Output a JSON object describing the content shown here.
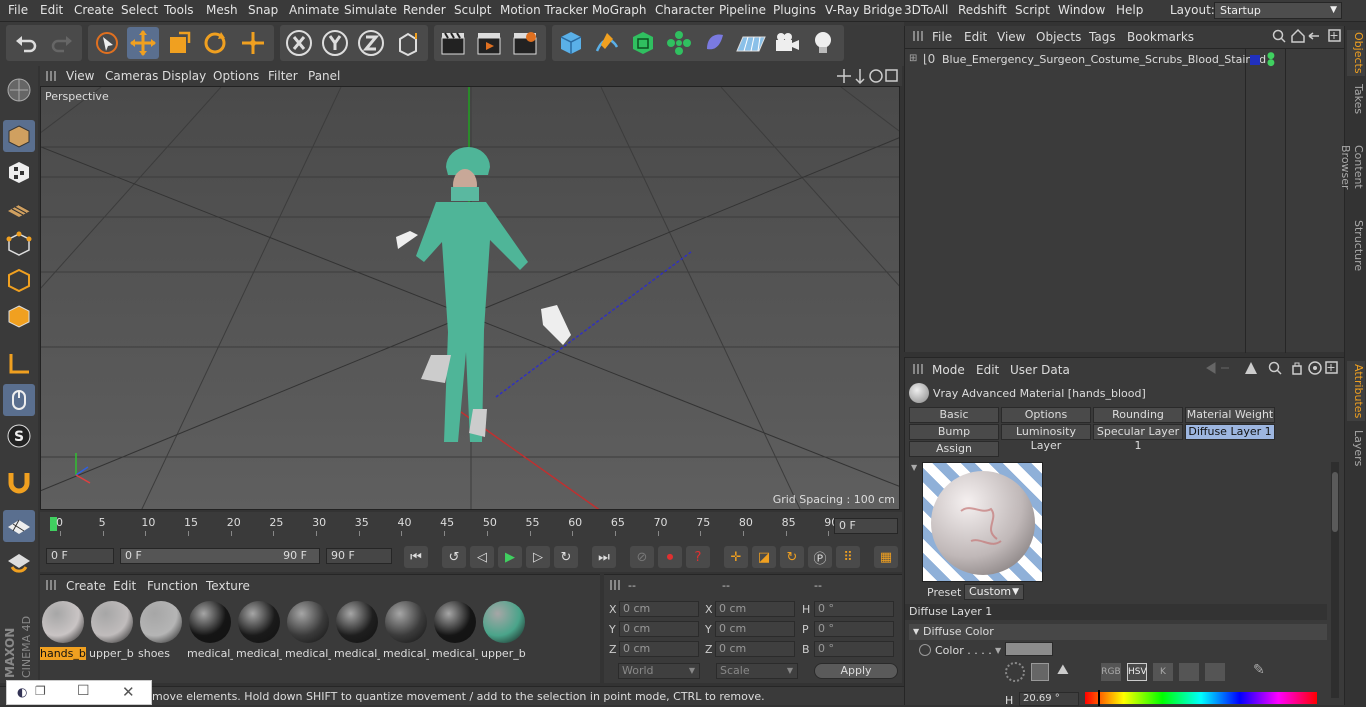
{
  "menubar": {
    "items": [
      "File",
      "Edit",
      "Create",
      "Select",
      "Tools",
      "Mesh",
      "Snap",
      "Animate",
      "Simulate",
      "Render",
      "Sculpt",
      "Motion Tracker",
      "MoGraph",
      "Character",
      "Pipeline",
      "Plugins",
      "V-Ray Bridge",
      "3DToAll",
      "Redshift",
      "Script",
      "Window",
      "Help"
    ],
    "layout_label": "Layout:",
    "layout_value": "Startup"
  },
  "viewport": {
    "menu": [
      "View",
      "Cameras",
      "Display",
      "Options",
      "Filter",
      "Panel"
    ],
    "label": "Perspective",
    "grid_spacing": "Grid Spacing : 100 cm"
  },
  "timeline": {
    "ticks": [
      "0",
      "5",
      "10",
      "15",
      "20",
      "25",
      "30",
      "35",
      "40",
      "45",
      "50",
      "55",
      "60",
      "65",
      "70",
      "75",
      "80",
      "85",
      "90"
    ],
    "current_frame": "0 F",
    "start_field": "0 F",
    "range_start": "0 F",
    "range_end": "90 F",
    "end_field": "90 F"
  },
  "materials": {
    "menu": [
      "Create",
      "Edit",
      "Function",
      "Texture"
    ],
    "items": [
      {
        "label": "hands_b",
        "color": "#c9c4c4"
      },
      {
        "label": "upper_b",
        "color": "#c0bcbc"
      },
      {
        "label": "shoes",
        "color": "#b5b5b5"
      },
      {
        "label": "medical_",
        "color": "#151515"
      },
      {
        "label": "medical_",
        "color": "#1a1a1a"
      },
      {
        "label": "medical_",
        "color": "#3a3a3a"
      },
      {
        "label": "medical_",
        "color": "#1e1e1e"
      },
      {
        "label": "medical_",
        "color": "#3b3b3b"
      },
      {
        "label": "medical_",
        "color": "#151515"
      },
      {
        "label": "upper_b",
        "color": "#4aa48a"
      }
    ]
  },
  "coords": {
    "headers": [
      "--",
      "--",
      "--"
    ],
    "rows": [
      {
        "a": "X",
        "av": "0 cm",
        "b": "X",
        "bv": "0 cm",
        "c": "H",
        "cv": "0 °"
      },
      {
        "a": "Y",
        "av": "0 cm",
        "b": "Y",
        "bv": "0 cm",
        "c": "P",
        "cv": "0 °"
      },
      {
        "a": "Z",
        "av": "0 cm",
        "b": "Z",
        "bv": "0 cm",
        "c": "B",
        "cv": "0 °"
      }
    ],
    "world": "World",
    "scale": "Scale",
    "apply": "Apply"
  },
  "objects": {
    "menu": [
      "File",
      "Edit",
      "View",
      "Objects",
      "Tags",
      "Bookmarks"
    ],
    "item": "Blue_Emergency_Surgeon_Costume_Scrubs_Blood_Stained"
  },
  "attributes": {
    "menu": [
      "Mode",
      "Edit",
      "User Data"
    ],
    "title": "Vray Advanced Material [hands_blood]",
    "tabs_row1": [
      "Basic",
      "Options",
      "Rounding",
      "Material Weight"
    ],
    "tabs_row2": [
      "Bump",
      "Luminosity Layer",
      "Specular Layer 1",
      "Diffuse Layer 1"
    ],
    "assign": "Assign",
    "preset_label": "Preset",
    "preset_value": "Custom",
    "section": "Diffuse Layer 1",
    "subsection": "Diffuse Color",
    "color_label": "Color . . . .",
    "h_label": "H",
    "h_value": "20.69 °",
    "mode_buttons": [
      "RGB",
      "HSV",
      "K"
    ]
  },
  "rightdock": {
    "tabs_top": [
      "Objects",
      "Takes",
      "Content Browser",
      "Structure"
    ],
    "tabs_bottom": [
      "Attributes",
      "Layers"
    ]
  },
  "status": {
    "text": "move elements. Hold down SHIFT to quantize movement / add to the selection in point mode, CTRL to remove."
  },
  "logo": {
    "line1": "MAXON",
    "line2": "CINEMA 4D"
  },
  "colors": {
    "accent": "#5a6f8f",
    "selected_tab": "#9db6e0",
    "highlight": "#f0a020",
    "figure": "#4fb598"
  }
}
